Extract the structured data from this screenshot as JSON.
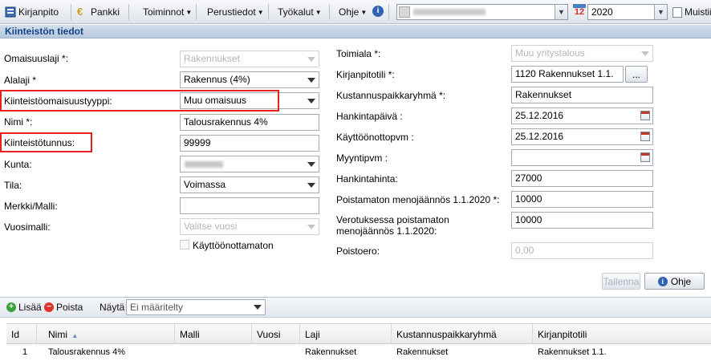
{
  "toolbar": {
    "kirjanpito": "Kirjanpito",
    "pankki": "Pankki",
    "toiminnot": "Toiminnot",
    "perustiedot": "Perustiedot",
    "tyokalut": "Työkalut",
    "ohje": "Ohje",
    "calendar_day": "12",
    "year": "2020",
    "muistiin": "Muistiin"
  },
  "section_title": "Kiinteistön tiedot",
  "left_form": {
    "omaisuuslaji_label": "Omaisuuslaji *:",
    "omaisuuslaji_value": "Rakennukset",
    "alalaji_label": "Alalaji *",
    "alalaji_value": "Rakennus (4%)",
    "tyyppi_label": "Kiinteistöomaisuustyyppi:",
    "tyyppi_value": "Muu omaisuus",
    "nimi_label": "Nimi *:",
    "nimi_value": "Talousrakennus 4%",
    "tunnus_label": "Kiinteistötunnus:",
    "tunnus_value": "99999",
    "kunta_label": "Kunta:",
    "tila_label": "Tila:",
    "tila_value": "Voimassa",
    "merkki_label": "Merkki/Malli:",
    "merkki_value": "",
    "vuosimalli_label": "Vuosimalli:",
    "vuosimalli_placeholder": "Valitse vuosi",
    "kayttoonottamaton_label": "Käyttöönottamaton"
  },
  "right_form": {
    "toimiala_label": "Toimiala *:",
    "toimiala_value": "Muu yritystalous",
    "kirjanpitotili_label": "Kirjanpitotili *:",
    "kirjanpitotili_value": "1120 Rakennukset 1.1.",
    "browse_label": "...",
    "kustannus_label": "Kustannuspaikkaryhmä *:",
    "kustannus_value": "Rakennukset",
    "hankintapaiva_label": "Hankintapäivä :",
    "hankintapaiva_value": "25.12.2016",
    "kayttoonotto_label": "Käyttöönottopvm :",
    "kayttoonotto_value": "25.12.2016",
    "myyntipvm_label": "Myyntipvm :",
    "myyntipvm_value": "",
    "hankintahinta_label": "Hankintahinta:",
    "hankintahinta_value": "27000",
    "poistamaton_label": "Poistamaton menojäännös 1.1.2020 *:",
    "poistamaton_value": "10000",
    "verotus_label_1": "Verotuksessa poistamaton",
    "verotus_label_2": "menojäännös 1.1.2020:",
    "verotus_value": "10000",
    "poistoero_label": "Poistoero:",
    "poistoero_value": "0,00"
  },
  "buttons": {
    "tallenna": "Tallenna",
    "ohje": "Ohje"
  },
  "grid_toolbar": {
    "lisaa": "Lisää",
    "poista": "Poista",
    "nayta_label": "Näytä",
    "nayta_value": "Ei määritelty"
  },
  "grid": {
    "columns": [
      "Id",
      "Nimi",
      "Malli",
      "Vuosi",
      "Laji",
      "Kustannuspaikkaryhmä",
      "Kirjanpitotili"
    ],
    "sort_indicator": "▲",
    "rows": [
      [
        "1",
        "Talousrakennus 4%",
        "",
        "",
        "Rakennukset",
        "Rakennukset",
        "Rakennukset 1.1."
      ]
    ]
  },
  "colors": {
    "accent": "#15428b",
    "highlight_border": "#e8201e"
  }
}
